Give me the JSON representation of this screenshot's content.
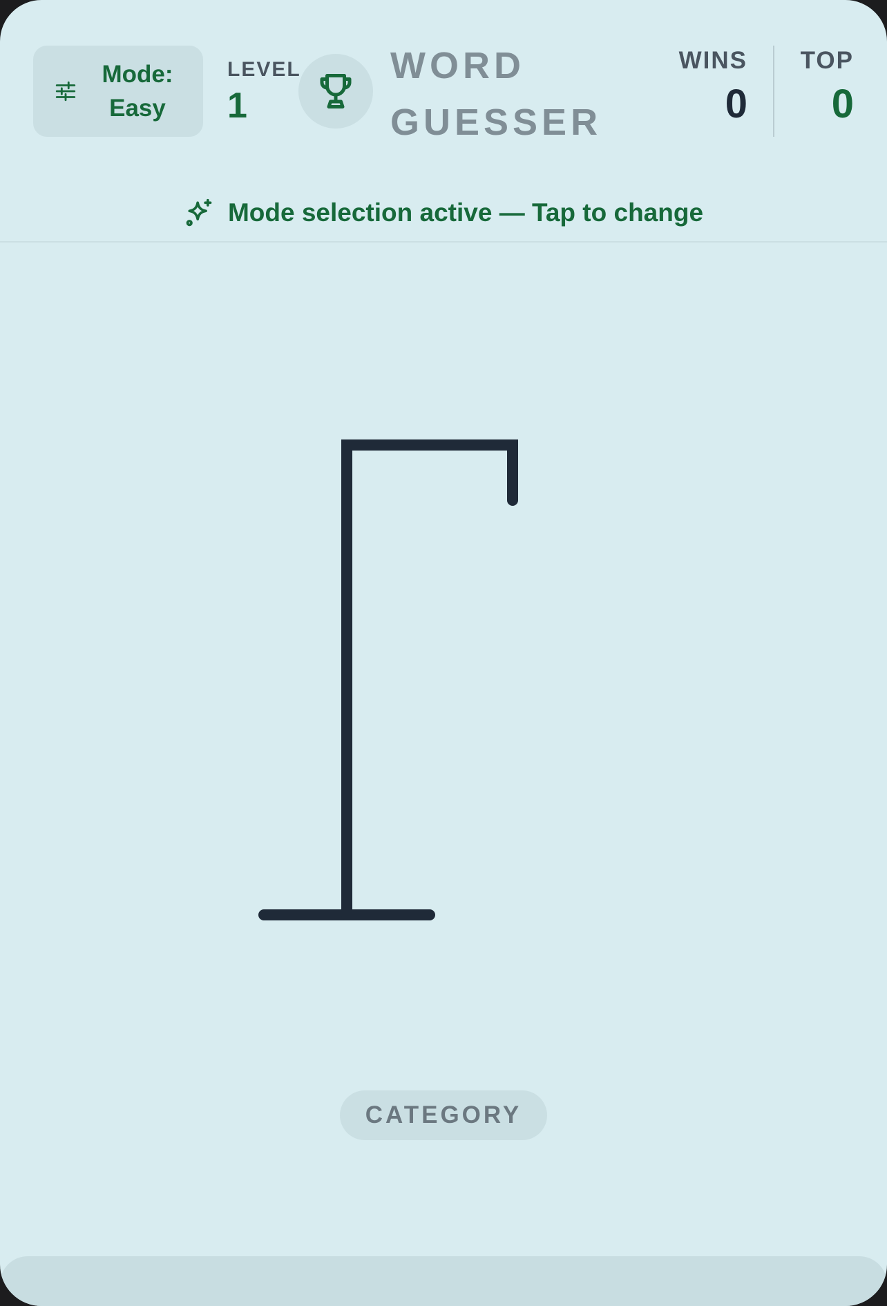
{
  "header": {
    "mode_label": "Mode:",
    "mode_value": "Easy",
    "level_label": "LEVEL",
    "level_value": "1",
    "title_line1": "WORD",
    "title_line2": "GUESSER",
    "wins_label": "WINS",
    "wins_value": "0",
    "top_label": "TOP",
    "top_value": "0"
  },
  "banner": {
    "text": "Mode selection active — Tap to change"
  },
  "game": {
    "category_label": "CATEGORY",
    "wrong_guesses": 0
  },
  "colors": {
    "accent": "#17693a",
    "background": "#d8ecf0",
    "gallows": "#1f2a38"
  },
  "icons": {
    "mode": "sliders-icon",
    "trophy": "trophy-icon",
    "banner": "sparkles-icon"
  }
}
